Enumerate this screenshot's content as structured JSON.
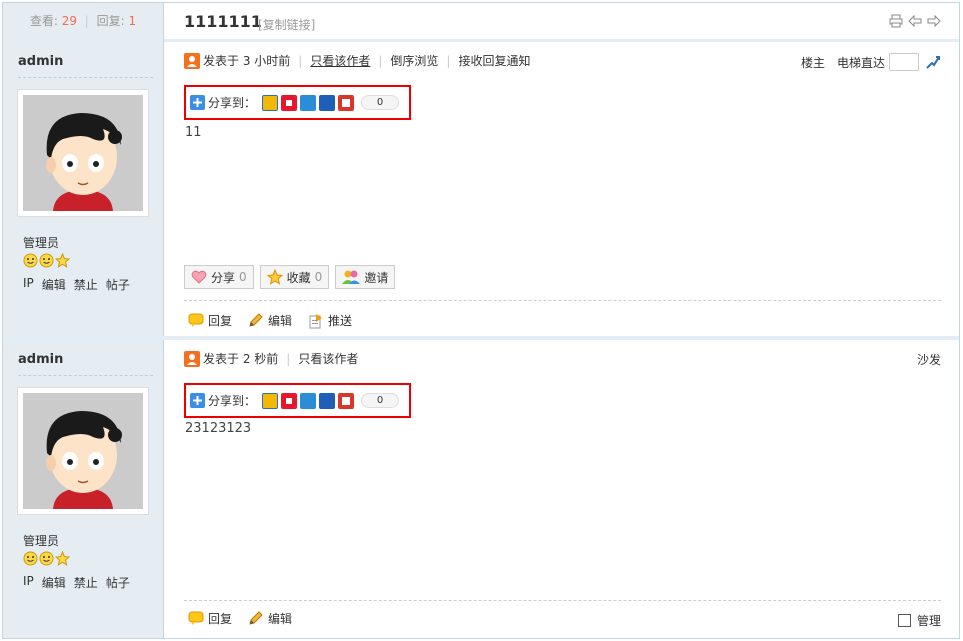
{
  "thread": {
    "views_label": "查看:",
    "views": "29",
    "replies_label": "回复:",
    "replies": "1",
    "title": "1111111",
    "copy_link": "[复制链接]"
  },
  "posts": [
    {
      "username": "admin",
      "role": "管理员",
      "links": [
        "IP",
        "编辑",
        "禁止",
        "帖子"
      ],
      "posted": "发表于 3 小时前",
      "only_author": "只看该作者",
      "reverse": "倒序浏览",
      "notify": "接收回复通知",
      "floor_label": "楼主",
      "elevator_label": "电梯直达",
      "share_label": "分享到：",
      "share_count": "0",
      "content": "11",
      "share_btn": "分享",
      "share_btn_count": "0",
      "fav_btn": "收藏",
      "fav_btn_count": "0",
      "invite_btn": "邀请",
      "reply": "回复",
      "edit": "编辑",
      "push": "推送"
    },
    {
      "username": "admin",
      "role": "管理员",
      "links": [
        "IP",
        "编辑",
        "禁止",
        "帖子"
      ],
      "posted": "发表于 2 秒前",
      "only_author": "只看该作者",
      "floor_label": "沙发",
      "share_label": "分享到：",
      "share_count": "0",
      "content": "23123123",
      "reply": "回复",
      "edit": "编辑",
      "manage": "管理"
    }
  ],
  "icons": {
    "share_services": [
      "qzone-icon",
      "weibo-icon",
      "pengyou-icon",
      "renren-icon",
      "tqq-icon"
    ],
    "colors": {
      "qzone": "#f5b800",
      "weibo": "#e6162d",
      "pengyou": "#2b8dd6",
      "renren": "#1f5fb8",
      "tqq": "#d9362b"
    }
  }
}
